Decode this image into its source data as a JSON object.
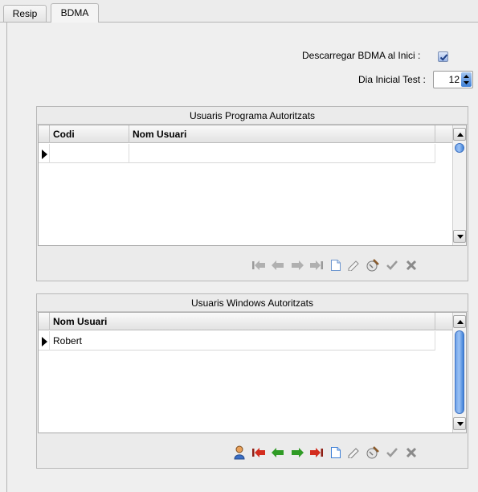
{
  "tabs": [
    {
      "label": "Resip",
      "active": false
    },
    {
      "label": "BDMA",
      "active": true
    }
  ],
  "options": {
    "download_label": "Descarregar BDMA al Inici :",
    "download_checked": true,
    "day_label": "Dia Inicial Test :",
    "day_value": "12"
  },
  "program_users": {
    "title": "Usuaris Programa Autoritzats",
    "columns": [
      "Codi",
      "Nom Usuari"
    ],
    "rows": [
      [
        "",
        ""
      ]
    ]
  },
  "windows_users": {
    "title": "Usuaris Windows Autoritzats",
    "columns": [
      "Nom Usuari"
    ],
    "rows": [
      [
        "Robert"
      ]
    ]
  },
  "nav_toolbar_icons": [
    "first-icon",
    "prior-icon",
    "next-icon",
    "last-icon",
    "insert-icon",
    "edit-icon",
    "cancel-edit-icon",
    "post-icon",
    "delete-icon"
  ],
  "colors": {
    "red_arrow": "#d32c1e",
    "green_arrow": "#2f9b25",
    "disabled": "#9a9a9a",
    "accent": "#3d7fd6"
  }
}
